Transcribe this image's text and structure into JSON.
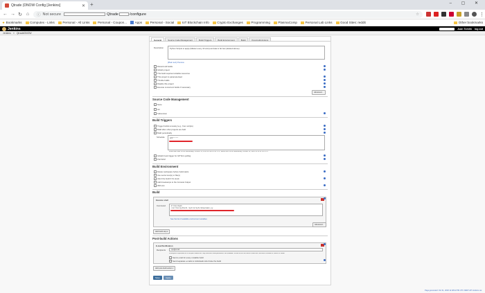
{
  "browser": {
    "tab_title": "Qtrade (DNOW Config [Jenkins]",
    "new_tab": "+",
    "window_controls": "– ▢ ✕",
    "not_secure": "Not secure",
    "url": "/configure",
    "url_prefix": "Qtrade"
  },
  "bookmarks": {
    "items": [
      "Bookmarks",
      "Computex - Links",
      "Personal - All Links",
      "Personal - Coupon...",
      "Apps",
      "Personal - Social",
      "IoT Blockchain Info",
      "Crypto Exchanges",
      "Programming",
      "PlasmaComp",
      "Personal Lab Links",
      "Good Sites: reddit"
    ],
    "other": "Other bookmarks"
  },
  "jenkins": {
    "brand": "Jenkins",
    "user": "Juan Tomlin",
    "logout": "log out",
    "crumbs": [
      "Jenkins",
      "QtradeDNOW"
    ]
  },
  "config": {
    "tabs": [
      "General",
      "Source Code Management",
      "Build Triggers",
      "Build Environment",
      "Build",
      "Post-build Actions"
    ],
    "general": {
      "description_label": "Description",
      "description_value": "Python Scripts to apply (Master every 10 and post data to fat                                        Get (deleted above)",
      "preview_link": "[Plain text] Preview",
      "options": [
        "Discard old builds",
        "GitHub project",
        "This build requires lockable resources",
        "This project is parameterised",
        "Throttle builds",
        "Disable this project",
        "Execute concurrent builds if necessary"
      ],
      "advanced": "Advanced..."
    },
    "scm": {
      "title": "Source Code Management",
      "options": [
        "None",
        "Git",
        "Subversion"
      ]
    },
    "triggers": {
      "title": "Build Triggers",
      "options": [
        "Trigger builds remotely (e.g., from scripts)",
        "Build after other projects are built",
        "Build periodically"
      ],
      "schedule_label": "Schedule",
      "schedule_value": "H/5 * * * *",
      "schedule_note": "Would last have run at Wednesday, October 31, 2018 12:48:21 PM UTC; would next run at Wednesday, October 31, 2018 12:51:21 PM UTC.",
      "more_options": [
        "GitHub hook trigger for GITScm polling",
        "Poll SCM"
      ]
    },
    "build_env": {
      "title": "Build Environment",
      "options": [
        "Delete workspace before build starts",
        "Use secret text(s) or file(s)",
        "Abort the build if it's stuck",
        "Add timestamps to the Console Output",
        "With Ant"
      ]
    },
    "build": {
      "title": "Build",
      "step_title": "Execute shell",
      "command_label": "Command",
      "command_lines": [
        "#!/bin/bash",
        "/usr/bin/python3 /opt/scripts/dnow/main.py",
        "echo done"
      ],
      "env_link": "See the list of available environment variables",
      "advanced": "Advanced...",
      "add_step": "Add build step ▾"
    },
    "post": {
      "title": "Post-build Actions",
      "step_title": "E-mail Notification",
      "recipients_label": "Recipients",
      "recipients_value": "ops@email",
      "note": "Whitespace-separated list of recipient addresses. May reference build parameters like $PARAM. E-mail will be sent when a build fails, becomes unstable or returns to stable.",
      "options": [
        "Send e-mail for every unstable build",
        "Send separate e-mails to individuals who broke the build"
      ],
      "add_action": "Add post-build action ▾"
    },
    "save": "Save",
    "apply": "Apply"
  },
  "footer": "Page generated: Oct 31, 2018 12:48:22 PM UTC   REST API   Jenkins ver."
}
